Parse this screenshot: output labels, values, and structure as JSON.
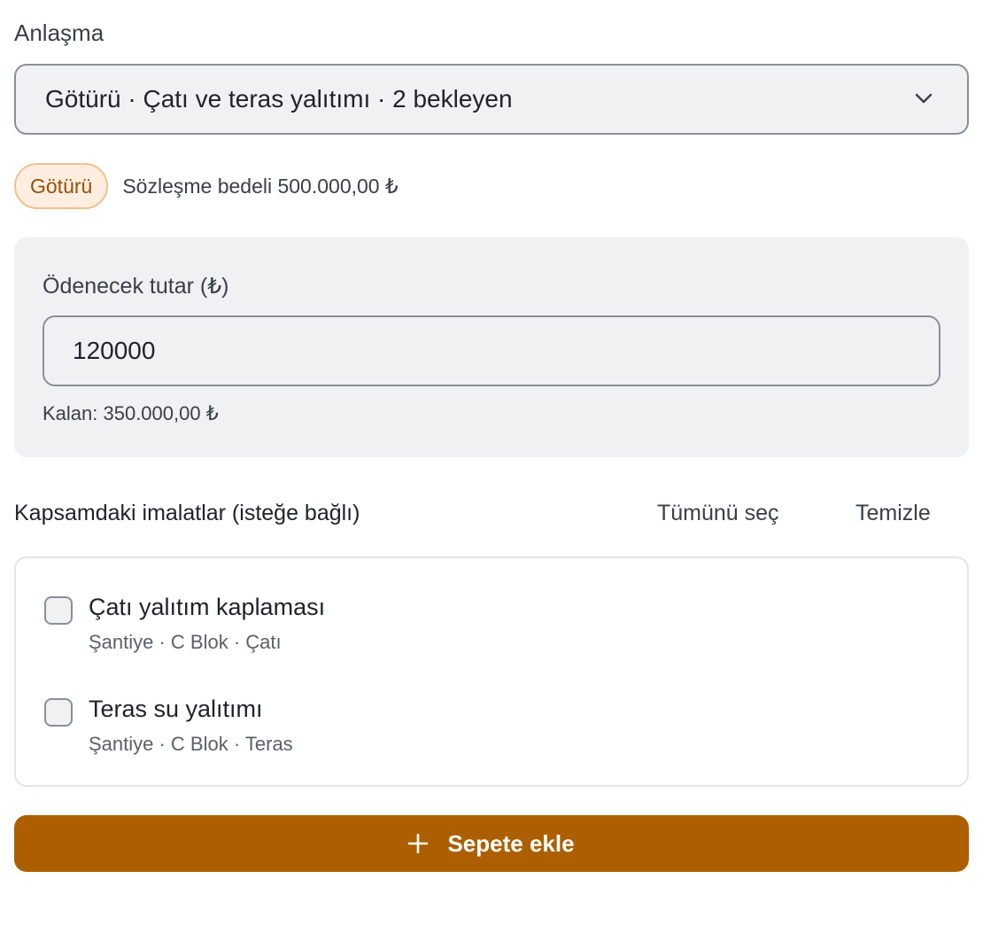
{
  "agreement": {
    "label": "Anlaşma",
    "selected": "Götürü · Çatı ve teras yalıtımı · 2 bekleyen",
    "dropdown_icon": "chevron-down-icon"
  },
  "contract": {
    "badge": "Götürü",
    "value_text": "Sözleşme bedeli 500.000,00 ₺",
    "badge_colors": {
      "bg": "#fdeee0",
      "border": "#f2c08d",
      "text": "#9a4f08"
    }
  },
  "payment": {
    "label": "Ödenecek tutar (₺)",
    "value": "120000",
    "remaining": "Kalan: 350.000,00 ₺"
  },
  "scope": {
    "title": "Kapsamdaki imalatlar (isteğe bağlı)",
    "select_all": "Tümünü seç",
    "clear": "Temizle",
    "items": [
      {
        "name": "Çatı yalıtım kaplaması",
        "location": "Şantiye · C Blok · Çatı",
        "checked": false
      },
      {
        "name": "Teras su yalıtımı",
        "location": "Şantiye · C Blok · Teras",
        "checked": false
      }
    ]
  },
  "actions": {
    "add_to_cart": "Sepete ekle",
    "add_icon": "plus-icon",
    "accent": "#ad5f00"
  }
}
